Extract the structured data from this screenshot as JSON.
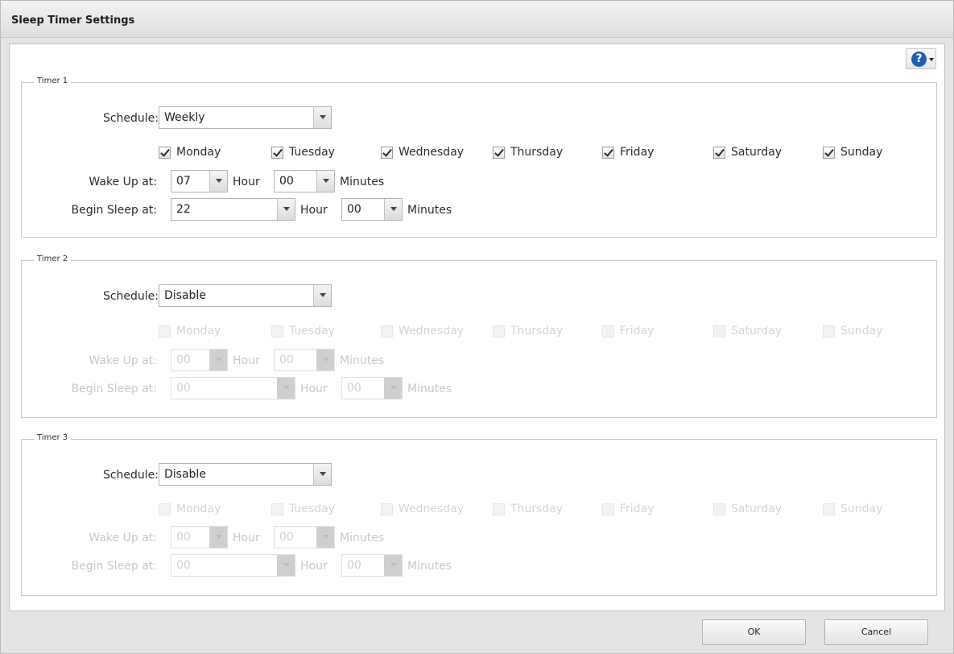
{
  "dialog": {
    "title": "Sleep Timer Settings",
    "help_icon": "question-circle-icon"
  },
  "labels": {
    "schedule": "Schedule:",
    "wake_up_at": "Wake Up at:",
    "begin_sleep_at": "Begin Sleep at:",
    "hour": "Hour",
    "minutes": "Minutes"
  },
  "days": [
    "Monday",
    "Tuesday",
    "Wednesday",
    "Thursday",
    "Friday",
    "Saturday",
    "Sunday"
  ],
  "timers": [
    {
      "legend": "Timer 1",
      "schedule": "Weekly",
      "enabled": true,
      "days_checked": [
        true,
        true,
        true,
        true,
        true,
        true,
        true
      ],
      "wake_hour": "07",
      "wake_minutes": "00",
      "sleep_hour": "22",
      "sleep_minutes": "00"
    },
    {
      "legend": "Timer 2",
      "schedule": "Disable",
      "enabled": false,
      "days_checked": [
        false,
        false,
        false,
        false,
        false,
        false,
        false
      ],
      "wake_hour": "00",
      "wake_minutes": "00",
      "sleep_hour": "00",
      "sleep_minutes": "00"
    },
    {
      "legend": "Timer 3",
      "schedule": "Disable",
      "enabled": false,
      "days_checked": [
        false,
        false,
        false,
        false,
        false,
        false,
        false
      ],
      "wake_hour": "00",
      "wake_minutes": "00",
      "sleep_hour": "00",
      "sleep_minutes": "00"
    }
  ],
  "buttons": {
    "ok": "OK",
    "cancel": "Cancel"
  },
  "colors": {
    "help_icon": "#1b5fae",
    "disabled_text": "#d4d4d4"
  }
}
